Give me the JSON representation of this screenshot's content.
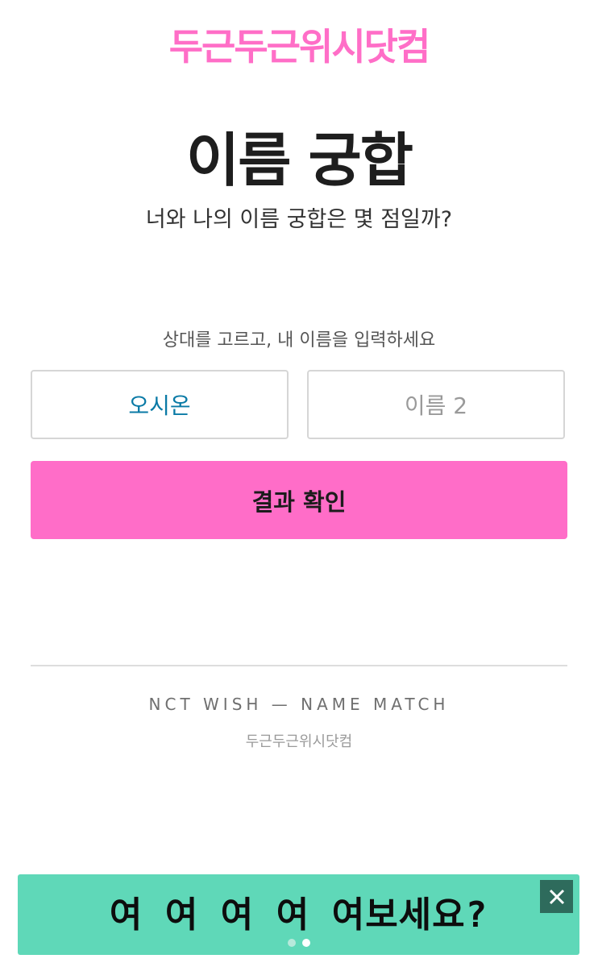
{
  "header": {
    "logo_text": "두근두근위시닷컴"
  },
  "main": {
    "title": "이름 궁합",
    "subtitle": "너와 나의 이름 궁합은 몇 점일까?",
    "instruction": "상대를 고르고, 내 이름을 입력하세요",
    "name1_value": "오시온",
    "name2_placeholder": "이름 2",
    "result_button": "결과 확인"
  },
  "footer": {
    "title_en": "NCT WISH — NAME MATCH",
    "site_name": "두근두근위시닷컴"
  },
  "ad_banner": {
    "text": "여 여 여 여 여보세요?",
    "close_icon": "close-icon",
    "carousel_total": 2,
    "carousel_active": 2
  },
  "colors": {
    "accent_pink": "#ff6dc8",
    "logo_pink": "#ff6ec7",
    "name1_blue": "#0a7aa6",
    "banner_mint": "#5fd8b8"
  }
}
